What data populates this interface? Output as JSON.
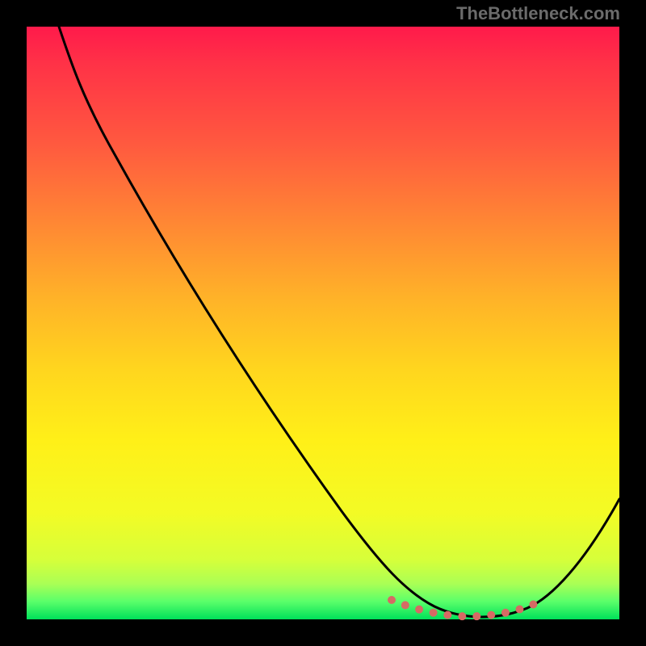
{
  "watermark": "TheBottleneck.com",
  "chart_data": {
    "type": "line",
    "title": "",
    "xlabel": "",
    "ylabel": "",
    "xlim": [
      0,
      100
    ],
    "ylim": [
      0,
      100
    ],
    "grid": false,
    "series": [
      {
        "name": "bottleneck-curve",
        "x": [
          5,
          10,
          20,
          30,
          40,
          50,
          60,
          66,
          70,
          74,
          78,
          82,
          86,
          90,
          95,
          100
        ],
        "y": [
          100,
          95,
          82,
          68,
          54,
          40,
          26,
          14,
          7,
          3,
          1,
          1,
          2,
          4,
          10,
          22
        ]
      }
    ],
    "highlight_region": {
      "name": "optimal-band",
      "x": [
        66,
        70,
        74,
        78,
        82,
        86
      ],
      "y": [
        3,
        2,
        1.5,
        1.5,
        2,
        3
      ]
    },
    "background_gradient": {
      "orientation": "vertical",
      "stops": [
        {
          "pos": 0,
          "color": "#ff1a4b"
        },
        {
          "pos": 50,
          "color": "#ffb328"
        },
        {
          "pos": 80,
          "color": "#fff018"
        },
        {
          "pos": 100,
          "color": "#00e05a"
        }
      ]
    }
  }
}
